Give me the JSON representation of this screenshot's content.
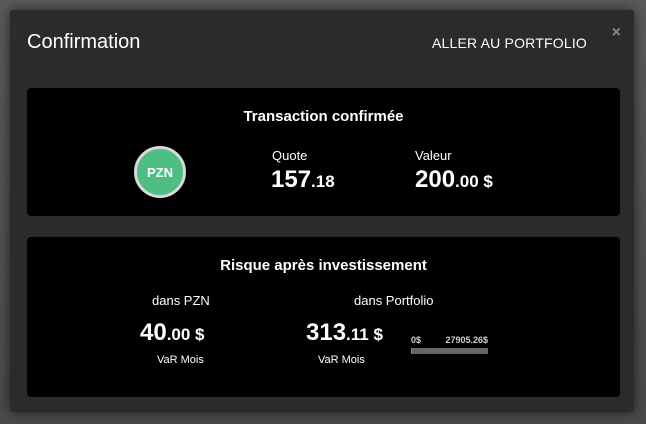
{
  "modal": {
    "title": "Confirmation",
    "goto_portfolio_label": "ALLER AU PORTFOLIO",
    "close_glyph": "×"
  },
  "transaction": {
    "title": "Transaction confirmée",
    "ticker": "PZN",
    "ticker_color": "#4dbd84",
    "quote_label": "Quote",
    "quote_int": "157",
    "quote_dec": ".18",
    "value_label": "Valeur",
    "value_int": "200",
    "value_dec": ".00 $"
  },
  "risk": {
    "title": "Risque après investissement",
    "pzn_label": "dans PZN",
    "pzn_int": "40",
    "pzn_dec": ".00 $",
    "pzn_sub": "VaR Mois",
    "portfolio_label": "dans Portfolio",
    "portfolio_int": "313",
    "portfolio_dec": ".11 $",
    "portfolio_sub": "VaR Mois",
    "scale_min": "0$",
    "scale_max": "27905.26$",
    "scale_fill_fraction": 0.011
  }
}
